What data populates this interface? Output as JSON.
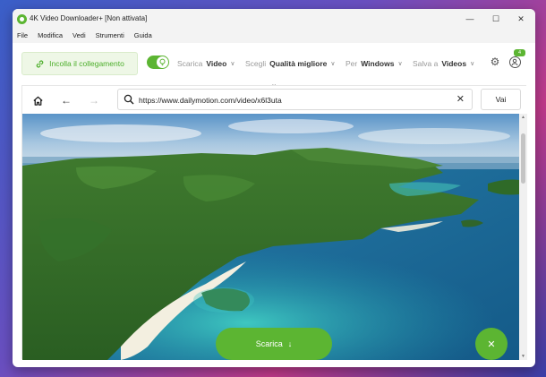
{
  "window": {
    "title": "4K Video Downloader+ [Non attivata]"
  },
  "menu": [
    "File",
    "Modifica",
    "Vedi",
    "Strumenti",
    "Guida"
  ],
  "toolbar": {
    "paste_label": "Incolla il collegamento",
    "smart_mode_on": true,
    "download_prefix": "Scarica",
    "download_value": "Video",
    "quality_prefix": "Scegli",
    "quality_value": "Qualità migliore",
    "platform_prefix": "Per",
    "platform_value": "Windows",
    "save_prefix": "Salva a",
    "save_value": "Videos",
    "account_badge": "4"
  },
  "browser": {
    "url": "https://www.dailymotion.com/video/x6l3uta",
    "go_label": "Vai"
  },
  "download_button_label": "Scarica",
  "colors": {
    "accent": "#5cb532"
  }
}
